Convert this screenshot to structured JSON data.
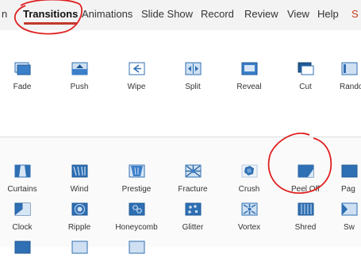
{
  "ribbon": {
    "tabs": [
      {
        "label": "n",
        "name": "tab-partial-left"
      },
      {
        "label": "Transitions",
        "name": "tab-transitions",
        "active": true
      },
      {
        "label": "Animations",
        "name": "tab-animations"
      },
      {
        "label": "Slide Show",
        "name": "tab-slide-show"
      },
      {
        "label": "Record",
        "name": "tab-record"
      },
      {
        "label": "Review",
        "name": "tab-review"
      },
      {
        "label": "View",
        "name": "tab-view"
      },
      {
        "label": "Help",
        "name": "tab-help"
      },
      {
        "label": "S",
        "name": "tab-partial-right",
        "accent": true
      }
    ],
    "active_color": "#c0392b"
  },
  "subtle": {
    "items": [
      {
        "label": "Fade",
        "icon": "fade-icon"
      },
      {
        "label": "Push",
        "icon": "push-icon"
      },
      {
        "label": "Wipe",
        "icon": "wipe-icon"
      },
      {
        "label": "Split",
        "icon": "split-icon"
      },
      {
        "label": "Reveal",
        "icon": "reveal-icon"
      },
      {
        "label": "Cut",
        "icon": "cut-icon"
      },
      {
        "label": "Rando",
        "icon": "random-bars-icon"
      }
    ]
  },
  "exciting": {
    "row1": [
      {
        "label": "Curtains",
        "icon": "curtains-icon"
      },
      {
        "label": "Wind",
        "icon": "wind-icon"
      },
      {
        "label": "Prestige",
        "icon": "prestige-icon"
      },
      {
        "label": "Fracture",
        "icon": "fracture-icon"
      },
      {
        "label": "Crush",
        "icon": "crush-icon"
      },
      {
        "label": "Peel Off",
        "icon": "peel-off-icon"
      },
      {
        "label": "Pag",
        "icon": "page-curl-icon"
      }
    ],
    "row2": [
      {
        "label": "Clock",
        "icon": "clock-icon"
      },
      {
        "label": "Ripple",
        "icon": "ripple-icon"
      },
      {
        "label": "Honeycomb",
        "icon": "honeycomb-icon"
      },
      {
        "label": "Glitter",
        "icon": "glitter-icon"
      },
      {
        "label": "Vortex",
        "icon": "vortex-icon"
      },
      {
        "label": "Shred",
        "icon": "shred-icon"
      },
      {
        "label": "Sw",
        "icon": "switch-icon"
      }
    ]
  },
  "annotation_color": "#e02020"
}
